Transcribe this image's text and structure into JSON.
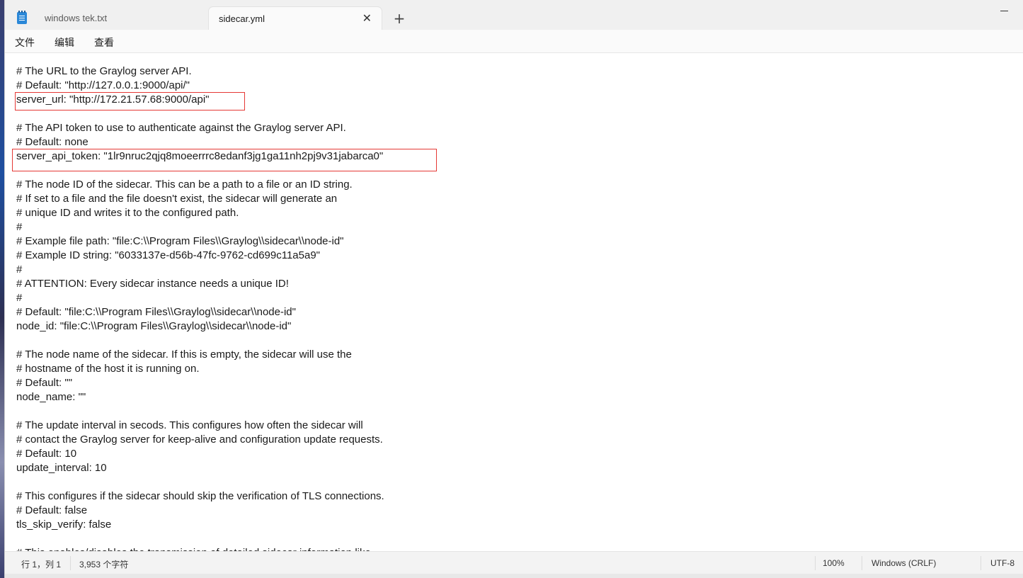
{
  "tabs": [
    {
      "label": "windows tek.txt",
      "active": false
    },
    {
      "label": "sidecar.yml",
      "active": true
    }
  ],
  "menu": [
    "文件",
    "编辑",
    "查看"
  ],
  "editor": {
    "lines": [
      "# The URL to the Graylog server API.",
      "# Default: \"http://127.0.0.1:9000/api/\"",
      "server_url: \"http://172.21.57.68:9000/api\"",
      "",
      "# The API token to use to authenticate against the Graylog server API.",
      "# Default: none",
      "server_api_token: \"1lr9nruc2qjq8moeerrrc8edanf3jg1ga11nh2pj9v31jabarca0\"",
      "",
      "# The node ID of the sidecar. This can be a path to a file or an ID string.",
      "# If set to a file and the file doesn't exist, the sidecar will generate an",
      "# unique ID and writes it to the configured path.",
      "#",
      "# Example file path: \"file:C:\\\\Program Files\\\\Graylog\\\\sidecar\\\\node-id\"",
      "# Example ID string: \"6033137e-d56b-47fc-9762-cd699c11a5a9\"",
      "#",
      "# ATTENTION: Every sidecar instance needs a unique ID!",
      "#",
      "# Default: \"file:C:\\\\Program Files\\\\Graylog\\\\sidecar\\\\node-id\"",
      "node_id: \"file:C:\\\\Program Files\\\\Graylog\\\\sidecar\\\\node-id\"",
      "",
      "# The node name of the sidecar. If this is empty, the sidecar will use the",
      "# hostname of the host it is running on.",
      "# Default: \"\"",
      "node_name: \"\"",
      "",
      "# The update interval in secods. This configures how often the sidecar will",
      "# contact the Graylog server for keep-alive and configuration update requests.",
      "# Default: 10",
      "update_interval: 10",
      "",
      "# This configures if the sidecar should skip the verification of TLS connections.",
      "# Default: false",
      "tls_skip_verify: false",
      "",
      "# This enables/disables the transmission of detailed sidecar information like"
    ],
    "highlight_color": "#e53935"
  },
  "status": {
    "position": "行 1，列 1",
    "char_count": "3,953 个字符",
    "zoom": "100%",
    "line_ending": "Windows (CRLF)",
    "encoding": "UTF-8"
  },
  "icons": {
    "app": "notepad-icon",
    "close": "close-icon",
    "new_tab": "plus-icon",
    "minimize": "minimize-icon"
  }
}
